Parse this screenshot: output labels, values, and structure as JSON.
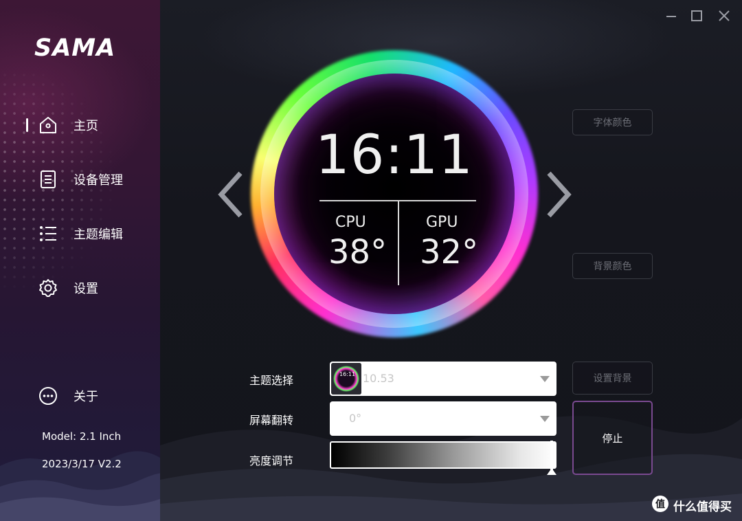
{
  "brand": {
    "logo_text": "SAMA"
  },
  "sidebar": {
    "items": [
      {
        "label": "主页",
        "icon": "home-icon",
        "active": true
      },
      {
        "label": "设备管理",
        "icon": "document-icon",
        "active": false
      },
      {
        "label": "主题编辑",
        "icon": "list-icon",
        "active": false
      },
      {
        "label": "设置",
        "icon": "gear-icon",
        "active": false
      }
    ],
    "about": {
      "label": "关于",
      "icon": "more-circle-icon"
    },
    "model": "Model: 2.1 Inch",
    "version": "2023/3/17 V2.2"
  },
  "window_controls": [
    "minimize-icon",
    "maximize-icon",
    "close-icon"
  ],
  "preview": {
    "time": "16:11",
    "cpu_label": "CPU",
    "cpu_value": "38°",
    "gpu_label": "GPU",
    "gpu_value": "32°"
  },
  "buttons": {
    "font_color": "字体颜色",
    "bg_color": "背景颜色",
    "set_background": "设置背景",
    "stop": "停止"
  },
  "form": {
    "theme_label": "主题选择",
    "theme_value": "10.53",
    "theme_thumb_text": "16:11",
    "rotate_label": "屏幕翻转",
    "rotate_value": "0°",
    "brightness_label": "亮度调节",
    "brightness_level": 1.0
  },
  "watermark": {
    "text": "什么值得买",
    "icon": "zhi-logo-icon"
  },
  "colors": {
    "sidebar_top": "#3d1735",
    "sidebar_bottom": "#1f1c3b",
    "main_bg": "#15161c",
    "stop_border": "#7a4a90",
    "ghost_text": "#6c6e76"
  }
}
